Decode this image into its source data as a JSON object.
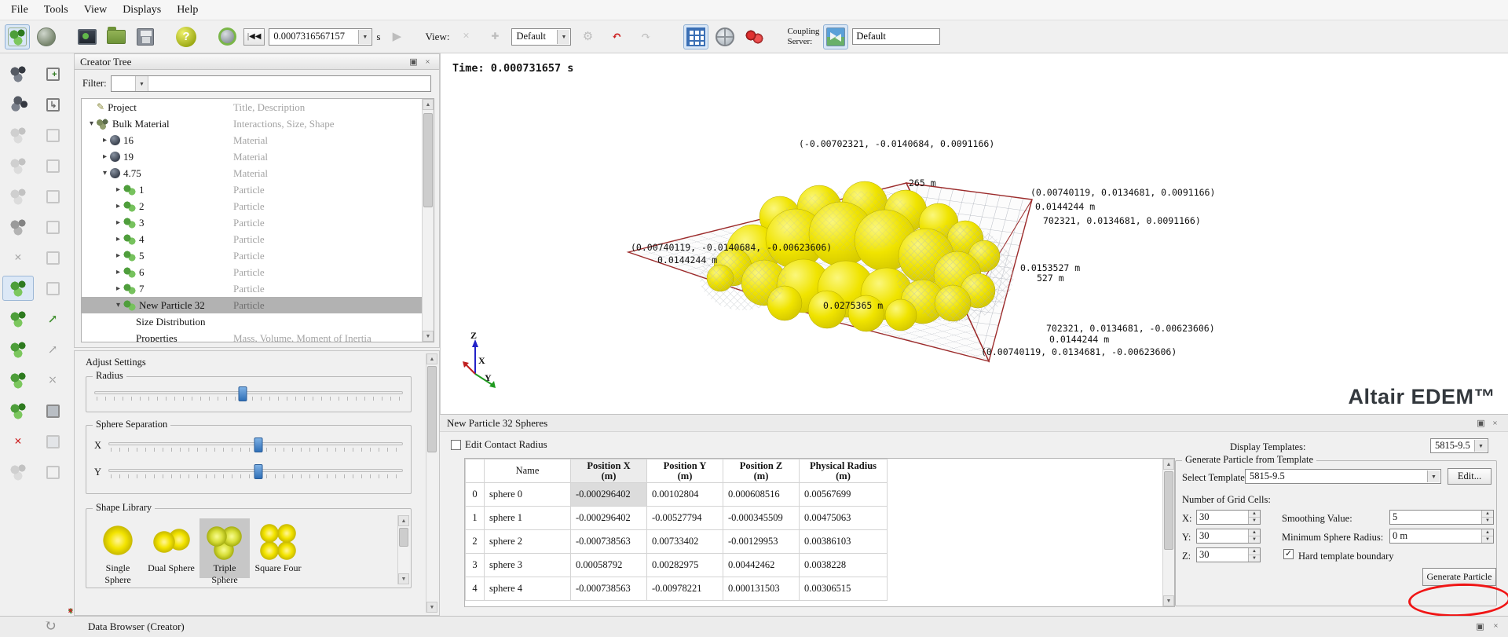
{
  "menu": {
    "items": [
      "File",
      "Tools",
      "View",
      "Displays",
      "Help"
    ]
  },
  "icons": {
    "help": "?",
    "dropdown": "▼",
    "spin_up": "▲",
    "spin_down": "▼",
    "scroll_up": "▲",
    "scroll_down": "▼",
    "check": "✓",
    "close": "×",
    "float": "▣",
    "undo": "↶",
    "redo": "↷",
    "refresh": "↻",
    "skip_back": "|◀◀",
    "play": "▶",
    "remove": "×",
    "add": "✚",
    "gear": "⚙",
    "pencil": "✎"
  },
  "toolbar": {
    "time_value": "0.0007316567157",
    "time_unit": "s",
    "view_label": "View:",
    "view_value": "Default",
    "coupling_line1": "Coupling",
    "coupling_line2": "Server:",
    "coupling_value": "Default"
  },
  "creator_tree": {
    "title": "Creator Tree",
    "filter_label": "Filter:",
    "items": [
      {
        "label": "Project",
        "desc": "Title, Description"
      },
      {
        "label": "Bulk Material",
        "desc": "Interactions, Size, Shape"
      },
      {
        "label": "16",
        "desc": "Material"
      },
      {
        "label": "19",
        "desc": "Material"
      },
      {
        "label": "4.75",
        "desc": "Material"
      },
      {
        "label": "1",
        "desc": "Particle"
      },
      {
        "label": "2",
        "desc": "Particle"
      },
      {
        "label": "3",
        "desc": "Particle"
      },
      {
        "label": "4",
        "desc": "Particle"
      },
      {
        "label": "5",
        "desc": "Particle"
      },
      {
        "label": "6",
        "desc": "Particle"
      },
      {
        "label": "7",
        "desc": "Particle"
      },
      {
        "label": "New Particle 32",
        "desc": "Particle"
      },
      {
        "label": "Size Distribution",
        "desc": ""
      },
      {
        "label": "Properties",
        "desc": "Mass, Volume, Moment of Inertia"
      }
    ]
  },
  "adjust": {
    "title": "Adjust Settings",
    "radius": "Radius",
    "separation": "Sphere Separation",
    "x": "X",
    "y": "Y",
    "library": "Shape Library",
    "shapes": [
      "Single Sphere",
      "Dual Sphere",
      "Triple Sphere",
      "Square Four"
    ]
  },
  "viewport": {
    "time": "Time: 0.000731657 s",
    "axis_z": "Z",
    "axis_x": "X",
    "axis_y": "Y",
    "watermark": "Altair EDEM™",
    "annotations": [
      "(-0.00702321, -0.0140684, 0.0091166)",
      "265 m",
      "(0.00740119, 0.0134681, 0.0091166)",
      "0.0144244 m",
      "702321, 0.0134681, 0.0091166)",
      "(0.00740119, -0.0140684, -0.00623606)",
      "0.0144244 m",
      "0.0153527 m",
      "527 m",
      "0.0275365 m",
      "702321, 0.0134681, -0.00623606)",
      "0.0144244 m",
      "(0.00740119, 0.0134681, -0.00623606)"
    ]
  },
  "spheres": {
    "title": "New Particle 32 Spheres",
    "edit_contact": "Edit Contact Radius",
    "h": {
      "name": "Name",
      "x1": "Position X",
      "x2": "(m)",
      "y1": "Position Y",
      "y2": "(m)",
      "z1": "Position Z",
      "z2": "(m)",
      "r1": "Physical Radius",
      "r2": "(m)"
    },
    "rows": [
      {
        "i": "0",
        "name": "sphere 0",
        "x": "-0.000296402",
        "y": "0.00102804",
        "z": "0.000608516",
        "r": "0.00567699"
      },
      {
        "i": "1",
        "name": "sphere 1",
        "x": "-0.000296402",
        "y": "-0.00527794",
        "z": "-0.000345509",
        "r": "0.00475063"
      },
      {
        "i": "2",
        "name": "sphere 2",
        "x": "-0.000738563",
        "y": "0.00733402",
        "z": "-0.00129953",
        "r": "0.00386103"
      },
      {
        "i": "3",
        "name": "sphere 3",
        "x": "0.00058792",
        "y": "0.00282975",
        "z": "0.00442462",
        "r": "0.0038228"
      },
      {
        "i": "4",
        "name": "sphere 4",
        "x": "-0.000738563",
        "y": "-0.00978221",
        "z": "0.000131503",
        "r": "0.00306515"
      }
    ]
  },
  "template": {
    "display_label": "Display Templates:",
    "display_value": "5815-9.5",
    "group": "Generate Particle from Template",
    "select_label": "Select Template:",
    "select_value": "5815-9.5",
    "edit": "Edit...",
    "grid_label": "Number of Grid Cells:",
    "x": "X:",
    "xv": "30",
    "y": "Y:",
    "yv": "30",
    "z": "Z:",
    "zv": "30",
    "smooth": "Smoothing Value:",
    "smoothv": "5",
    "minr": "Minimum Sphere Radius:",
    "minrv": "0 m",
    "hard": "Hard template boundary",
    "generate": "Generate Particle"
  },
  "status": {
    "title": "Data Browser (Creator)"
  }
}
